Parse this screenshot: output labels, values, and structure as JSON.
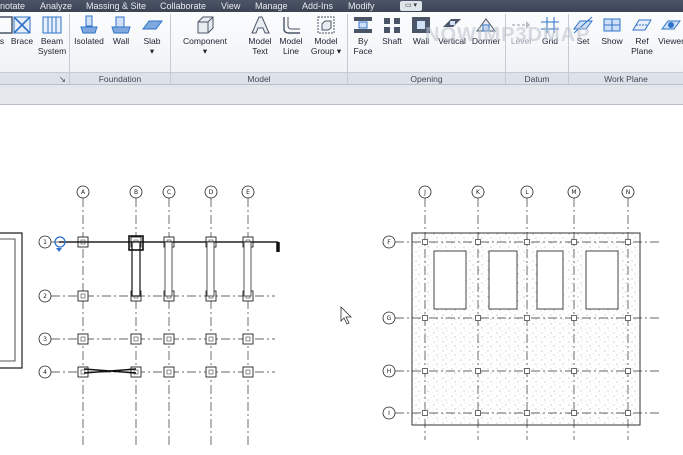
{
  "menu": [
    "notate",
    "Analyze",
    "Massing & Site",
    "Collaborate",
    "View",
    "Manage",
    "Add-Ins",
    "Modify"
  ],
  "menu_extra": "▭ ▾",
  "ribbon": {
    "structure_buttons": [
      [
        "s",
        ""
      ],
      [
        "Brace",
        ""
      ],
      [
        "Beam",
        "System"
      ]
    ],
    "foundation_buttons": [
      [
        "Isolated",
        ""
      ],
      [
        "Wall",
        ""
      ],
      [
        "Slab",
        "▾"
      ]
    ],
    "model_buttons": [
      [
        "Component",
        "▾"
      ],
      [
        "Model",
        "Text"
      ],
      [
        "Model",
        "Line"
      ],
      [
        "Model",
        "Group ▾"
      ]
    ],
    "opening_buttons": [
      [
        "By",
        "Face"
      ],
      [
        "Shaft",
        ""
      ],
      [
        "Wall",
        ""
      ],
      [
        "Vertical",
        ""
      ],
      [
        "Dormer",
        ""
      ]
    ],
    "datum_buttons": [
      [
        "Level",
        ""
      ],
      [
        "Grid",
        ""
      ]
    ],
    "workplane_buttons": [
      [
        "Set",
        ""
      ],
      [
        "Show",
        ""
      ],
      [
        "Ref",
        "Plane"
      ],
      [
        "Viewer",
        ""
      ]
    ],
    "panels": {
      "structure_tail": "↘",
      "foundation": "Foundation",
      "model": "Model",
      "opening": "Opening",
      "datum": "Datum",
      "workplane": "Work Plane"
    },
    "watermark": "NOWIMP3DMAP",
    "icon_color": "#2f73c8"
  },
  "plan_left": {
    "columns": [
      "A",
      "B",
      "C",
      "D",
      "E"
    ],
    "rows": [
      "1",
      "2",
      "3",
      "4"
    ]
  },
  "plan_right": {
    "columns": [
      "J",
      "K",
      "L",
      "M",
      "N"
    ],
    "rows": [
      "F",
      "G",
      "H",
      "I"
    ]
  }
}
